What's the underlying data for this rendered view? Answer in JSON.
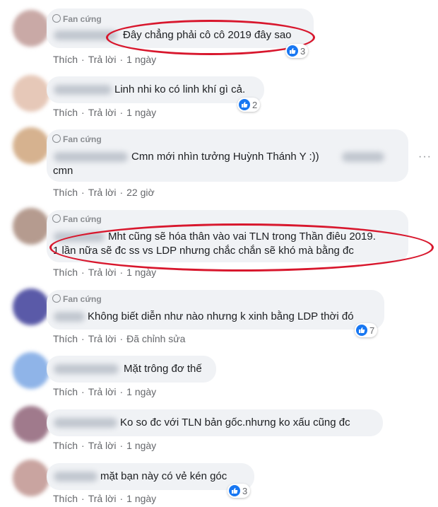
{
  "badge_label": "Fan cứng",
  "action_like": "Thích",
  "action_reply": "Trả lời",
  "comments": [
    {
      "text": "Đây chẳng phải cô cô 2019 đây sao",
      "time": "1 ngày",
      "reactions": "3",
      "avatar_color": "#c9a9a6"
    },
    {
      "text": "Linh nhi ko có linh khí gì cả.",
      "time": "1 ngày",
      "reactions": "2",
      "avatar_color": "#e6c8b8"
    },
    {
      "text1": "Cmn mới nhìn tưởng Huỳnh Thánh Y :))",
      "text2": "cmn",
      "time": "22 giờ",
      "avatar_color": "#d6b28f"
    },
    {
      "text1": "Mht cũng sẽ hóa thân vào vai TLN trong Thần điêu 2019.",
      "text2": "1 lần nữa sẽ đc ss vs LDP nhưng chắc chắn sẽ khó mà bằng đc",
      "time": "1 ngày",
      "avatar_color": "#b59b8f"
    },
    {
      "text": "Không biết diễn như nào nhưng k xinh bằng LDP thời đó",
      "time": "Đã chỉnh sửa",
      "reactions": "7",
      "avatar_color": "#5a5aa8"
    },
    {
      "text": "Mặt trông đơ thế",
      "time": "1 ngày",
      "avatar_color": "#8fb4e8"
    },
    {
      "text": "Ko so đc với TLN bản gốc.nhưng ko xấu cũng đc",
      "time": "1 ngày",
      "avatar_color": "#a07a8c"
    },
    {
      "text": "mặt bạn này có vẻ kén góc",
      "time": "1 ngày",
      "reactions": "3",
      "avatar_color": "#c9a4a0"
    }
  ],
  "colors": {
    "highlight": "#d8172d",
    "like": "#1877f2",
    "bubble": "#f0f2f5"
  }
}
